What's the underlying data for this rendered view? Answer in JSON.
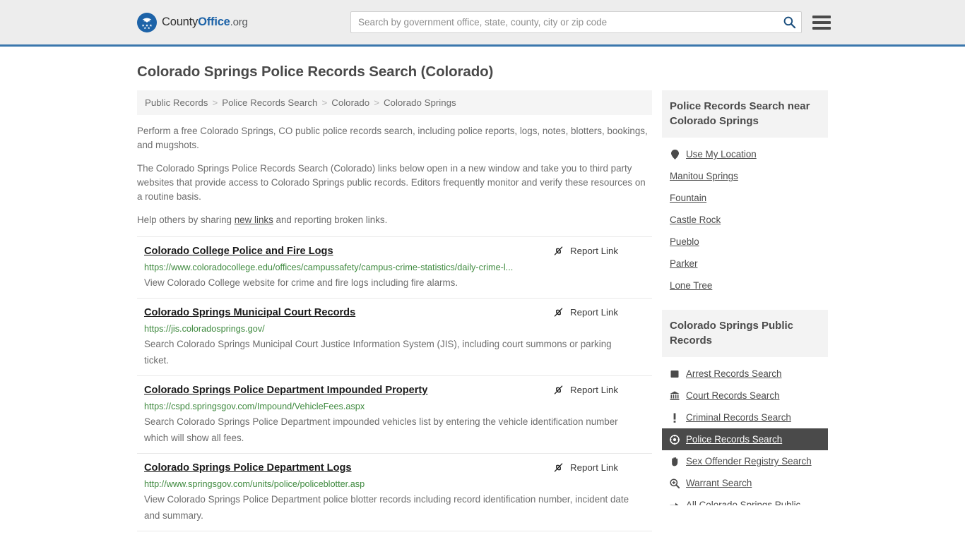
{
  "header": {
    "logo": {
      "part1": "County",
      "part2": "Office",
      "part3": ".org",
      "icon": "eagle-seal-icon"
    },
    "search": {
      "placeholder": "Search by government office, state, county, city or zip code",
      "value": "",
      "button_icon": "search-icon"
    },
    "menu_icon": "hamburger-menu-icon",
    "accent_color": "#3a77ad"
  },
  "page": {
    "title": "Colorado Springs Police Records Search (Colorado)"
  },
  "breadcrumb": {
    "separator": ">",
    "items": [
      {
        "label": "Public Records",
        "current": false
      },
      {
        "label": "Police Records Search",
        "current": false
      },
      {
        "label": "Colorado",
        "current": false
      },
      {
        "label": "Colorado Springs",
        "current": true
      }
    ]
  },
  "intro": {
    "p1": "Perform a free Colorado Springs, CO public police records search, including police reports, logs, notes, blotters, bookings, and mugshots.",
    "p2": "The Colorado Springs Police Records Search (Colorado) links below open in a new window and take you to third party websites that provide access to Colorado Springs public records. Editors frequently monitor and verify these resources on a routine basis.",
    "p3_before": "Help others by sharing ",
    "p3_link": "new links",
    "p3_after": " and reporting broken links."
  },
  "report_label": "Report Link",
  "report_icon": "broken-link-icon",
  "results": [
    {
      "title": "Colorado College Police and Fire Logs",
      "url": "https://www.coloradocollege.edu/offices/campussafety/campus-crime-statistics/daily-crime-l...",
      "description": "View Colorado College website for crime and fire logs including fire alarms."
    },
    {
      "title": "Colorado Springs Municipal Court Records",
      "url": "https://jis.coloradosprings.gov/",
      "description": "Search Colorado Springs Municipal Court Justice Information System (JIS), including court summons or parking ticket."
    },
    {
      "title": "Colorado Springs Police Department Impounded Property",
      "url": "https://cspd.springsgov.com/Impound/VehicleFees.aspx",
      "description": "Search Colorado Springs Police Department impounded vehicles list by entering the vehicle identification number which will show all fees."
    },
    {
      "title": "Colorado Springs Police Department Logs",
      "url": "http://www.springsgov.com/units/police/policeblotter.asp",
      "description": "View Colorado Springs Police Department police blotter records including record identification number, incident date and summary."
    }
  ],
  "sidebar": {
    "nearby": {
      "heading": "Police Records Search near Colorado Springs",
      "items": [
        {
          "label": "Use My Location",
          "icon": "map-pin-icon",
          "active": false
        },
        {
          "label": "Manitou Springs",
          "icon": "",
          "active": false
        },
        {
          "label": "Fountain",
          "icon": "",
          "active": false
        },
        {
          "label": "Castle Rock",
          "icon": "",
          "active": false
        },
        {
          "label": "Pueblo",
          "icon": "",
          "active": false
        },
        {
          "label": "Parker",
          "icon": "",
          "active": false
        },
        {
          "label": "Lone Tree",
          "icon": "",
          "active": false
        }
      ]
    },
    "public_records": {
      "heading": "Colorado Springs Public Records",
      "items": [
        {
          "label": "Arrest Records Search",
          "icon": "fingerprint-icon",
          "active": false
        },
        {
          "label": "Court Records Search",
          "icon": "courthouse-icon",
          "active": false
        },
        {
          "label": "Criminal Records Search",
          "icon": "exclamation-icon",
          "active": false
        },
        {
          "label": "Police Records Search",
          "icon": "police-badge-icon",
          "active": true
        },
        {
          "label": "Sex Offender Registry Search",
          "icon": "hand-icon",
          "active": false
        },
        {
          "label": "Warrant Search",
          "icon": "magnifier-plus-icon",
          "active": false
        },
        {
          "label": "All Colorado Springs Public",
          "icon": "arrow-right-icon",
          "active": false
        }
      ]
    }
  }
}
